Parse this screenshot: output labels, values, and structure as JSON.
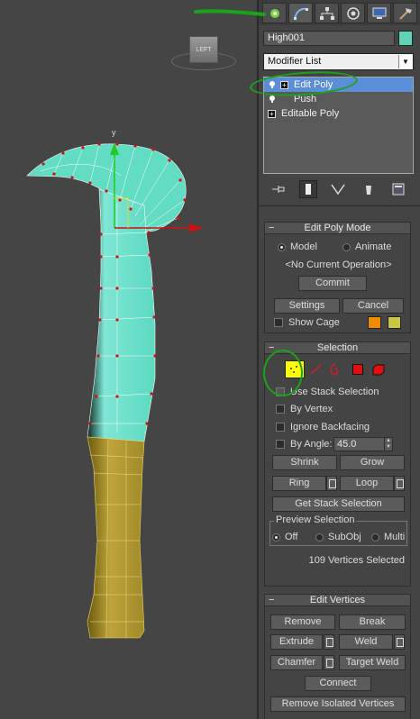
{
  "viewport": {
    "cube_label": "LEFT",
    "axis_y": "y"
  },
  "tabs": [
    {
      "name": "create",
      "icon": "star-icon"
    },
    {
      "name": "modify",
      "icon": "modify-curve-icon"
    },
    {
      "name": "hierarchy",
      "icon": "hierarchy-icon"
    },
    {
      "name": "motion",
      "icon": "motion-icon"
    },
    {
      "name": "display",
      "icon": "display-monitor-icon"
    },
    {
      "name": "utilities",
      "icon": "hammer-icon"
    }
  ],
  "object": {
    "name": "High001",
    "color": "#5fd3b7"
  },
  "modifier_list": {
    "label": "Modifier List"
  },
  "stack": [
    {
      "label": "Edit Poly",
      "selected": true
    },
    {
      "label": "Push",
      "selected": false
    },
    {
      "label": "Editable Poly",
      "selected": false
    }
  ],
  "edit_poly_mode": {
    "title": "Edit Poly Mode",
    "model": "Model",
    "animate": "Animate",
    "current_op": "<No Current Operation>",
    "commit": "Commit",
    "settings": "Settings",
    "cancel": "Cancel",
    "show_cage": "Show Cage",
    "cage_colors": [
      "#f08c00",
      "#c8c846"
    ]
  },
  "selection": {
    "title": "Selection",
    "use_stack_selection": "Use Stack Selection",
    "by_vertex": "By Vertex",
    "ignore_backfacing": "Ignore Backfacing",
    "by_angle": "By Angle:",
    "angle_value": "45.0",
    "shrink": "Shrink",
    "grow": "Grow",
    "ring": "Ring",
    "loop": "Loop",
    "get_stack_selection": "Get Stack Selection",
    "preview_title": "Preview Selection",
    "preview_off": "Off",
    "preview_subobj": "SubObj",
    "preview_multi": "Multi",
    "status": "109 Vertices Selected"
  },
  "edit_vertices": {
    "title": "Edit Vertices",
    "remove": "Remove",
    "break": "Break",
    "extrude": "Extrude",
    "weld": "Weld",
    "chamfer": "Chamfer",
    "target_weld": "Target Weld",
    "connect": "Connect",
    "remove_isolated": "Remove Isolated Vertices"
  },
  "annotation_color": "#1aa31a"
}
